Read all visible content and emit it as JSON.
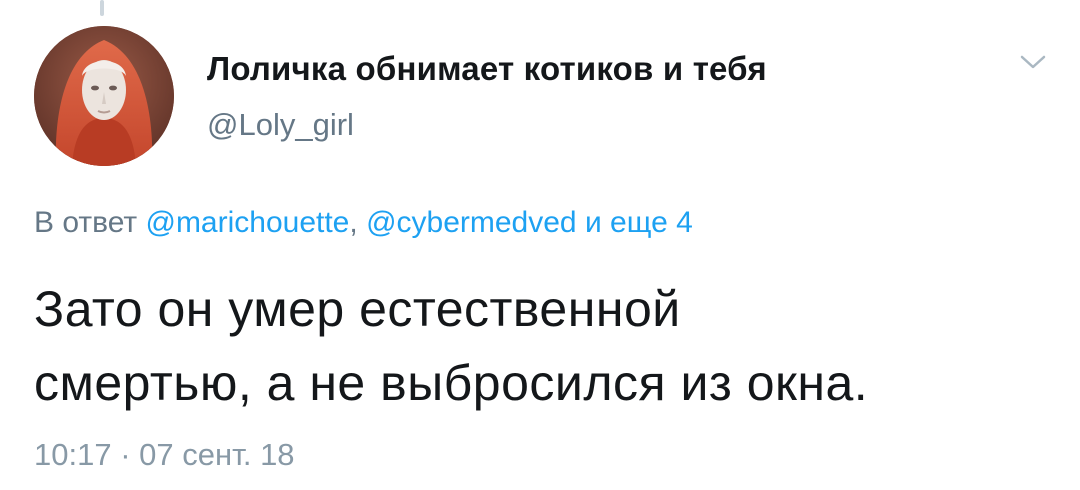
{
  "author": {
    "display_name": "Лоличка обнимает котиков и тебя",
    "handle": "@Loly_girl",
    "avatar_icon": "avatar-portrait"
  },
  "menu": {
    "icon": "chevron-down-icon"
  },
  "reply": {
    "prefix": "В ответ",
    "mention_1": "@marichouette",
    "separator": ",",
    "mention_2": "@cybermedved",
    "suffix": "и еще 4"
  },
  "tweet": {
    "line_1": "Зато он умер естественной",
    "line_2": "смертью, а не выбросился из окна."
  },
  "meta": {
    "timestamp": "10:17 · 07 сент. 18"
  },
  "colors": {
    "text": "#14171a",
    "secondary": "#657786",
    "link": "#1da1f2"
  }
}
